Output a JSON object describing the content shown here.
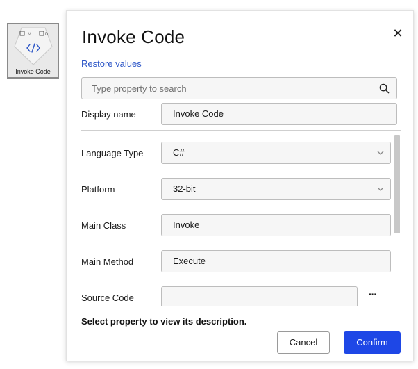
{
  "node": {
    "label": "Invoke Code",
    "icon": "code-icon",
    "port_left": "M",
    "port_right": "D"
  },
  "dialog": {
    "title": "Invoke Code",
    "close_icon": "close-icon",
    "restore_label": "Restore values",
    "search": {
      "placeholder": "Type property to search",
      "value": ""
    },
    "display_name": {
      "label": "Display name",
      "value": "Invoke Code"
    },
    "properties": {
      "language_type": {
        "label": "Language Type",
        "value": "C#"
      },
      "platform": {
        "label": "Platform",
        "value": "32-bit"
      },
      "main_class": {
        "label": "Main Class",
        "value": "Invoke"
      },
      "main_method": {
        "label": "Main Method",
        "value": "Execute"
      },
      "source_code": {
        "label": "Source Code",
        "value": "",
        "more_label": "···"
      }
    },
    "description": "Select property to view its description.",
    "buttons": {
      "cancel": "Cancel",
      "confirm": "Confirm"
    }
  },
  "colors": {
    "accent": "#1e47e6",
    "link": "#2b55c7"
  }
}
